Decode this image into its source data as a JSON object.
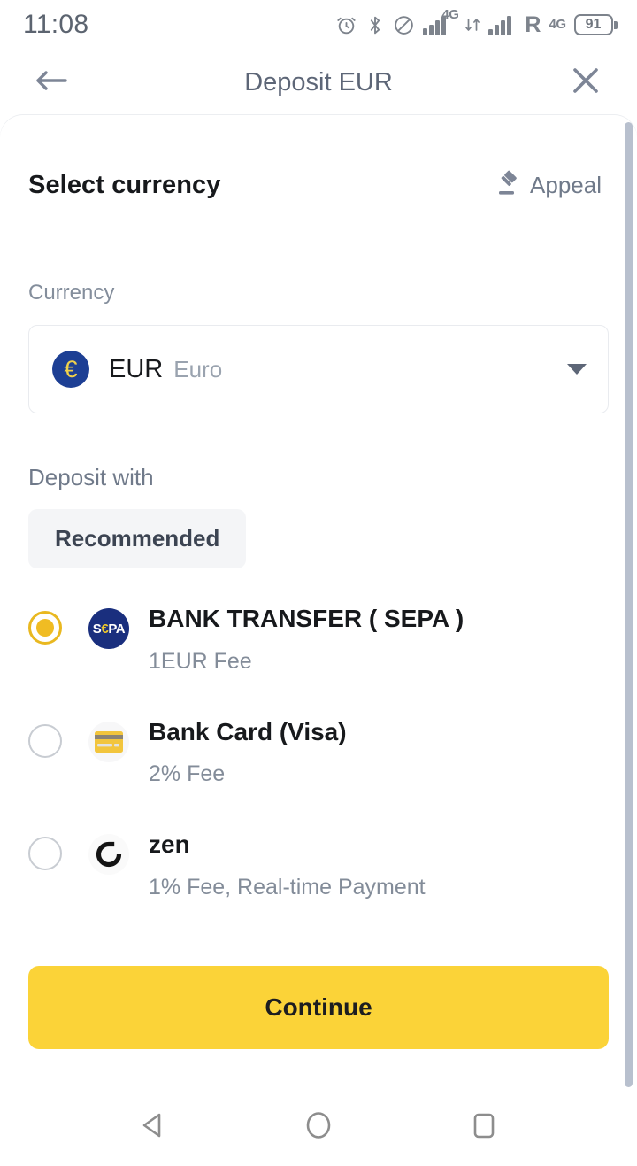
{
  "status_bar": {
    "time": "11:08",
    "battery_level": "91",
    "network_tag_primary": "4G",
    "network_tag_secondary": "4G",
    "roaming_label": "R",
    "icons": [
      "alarm-icon",
      "bluetooth-icon",
      "do-not-disturb-icon",
      "signal-bars-icon",
      "data-transfer-icon",
      "signal-bars-secondary-icon",
      "roaming-icon",
      "battery-icon"
    ]
  },
  "header": {
    "title": "Deposit EUR",
    "back_icon": "arrow-left-icon",
    "close_icon": "close-icon"
  },
  "section": {
    "title": "Select currency",
    "appeal_label": "Appeal",
    "appeal_icon": "gavel-icon"
  },
  "currency_field": {
    "label": "Currency",
    "badge_symbol": "€",
    "code": "EUR",
    "name": "Euro",
    "caret_icon": "chevron-down-icon"
  },
  "deposit_with": {
    "label": "Deposit with",
    "tabs": [
      {
        "label": "Recommended",
        "selected": true
      }
    ]
  },
  "methods": [
    {
      "id": "bank-transfer-sepa",
      "title": "BANK TRANSFER ( SEPA )",
      "subtitle": "1EUR Fee",
      "logo": "sepa-logo-icon",
      "logo_text": "SEPA",
      "selected": true
    },
    {
      "id": "bank-card-visa",
      "title": "Bank Card (Visa)",
      "subtitle": "2% Fee",
      "logo": "credit-card-icon",
      "selected": false
    },
    {
      "id": "zen",
      "title": "zen",
      "subtitle": "1% Fee, Real-time Payment",
      "logo": "zen-logo-icon",
      "selected": false
    }
  ],
  "continue_button": {
    "label": "Continue",
    "color": "#fbd338"
  },
  "nav_bar": {
    "back_icon": "nav-back-triangle-icon",
    "home_icon": "nav-home-circle-icon",
    "recents_icon": "nav-recents-square-icon"
  },
  "colors": {
    "accent_yellow": "#fbd338",
    "sepa_blue": "#1a2f7e",
    "euro_blue": "#1d3f94",
    "text_dark": "#17191c",
    "text_muted": "#848e9c"
  }
}
